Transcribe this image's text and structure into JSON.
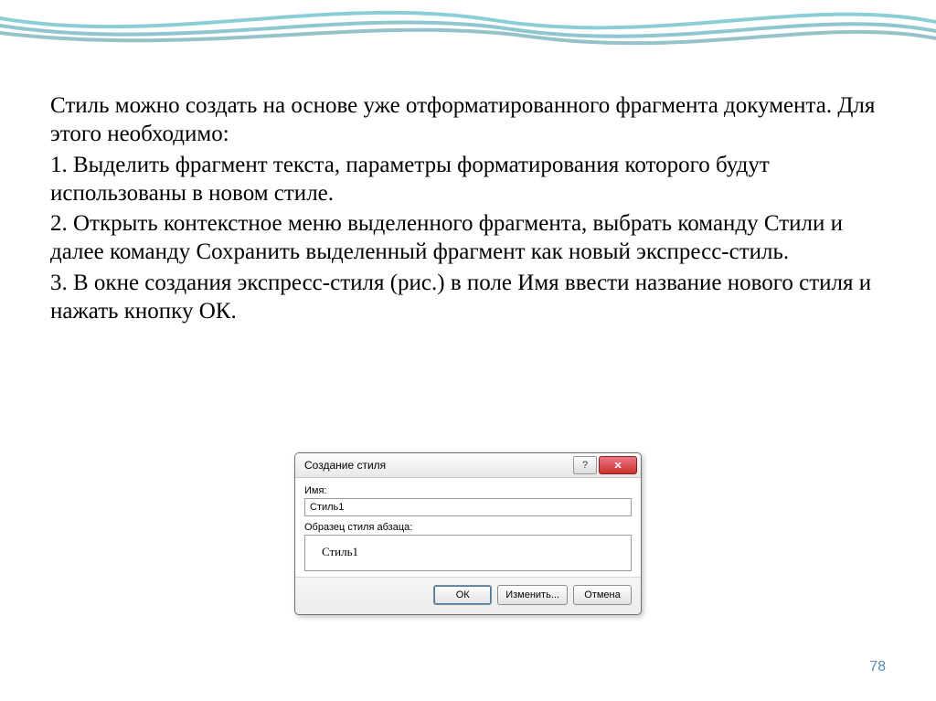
{
  "text": {
    "p1": "Стиль можно создать на основе уже отформатированного фрагмента документа. Для этого необходимо:",
    "p2": "1. Выделить фрагмент текста, параметры форматирования которого будут использованы в новом стиле.",
    "p3": "2. Открыть контекстное меню выделенного фрагмента, выбрать команду Стили и далее команду Сохранить выделенный фрагмент как новый экспресс-стиль.",
    "p4": "3. В окне создания экспресс-стиля (рис.) в поле Имя ввести название нового стиля и нажать кнопку ОК."
  },
  "dialog": {
    "title": "Создание стиля",
    "help_symbol": "?",
    "close_symbol": "x",
    "name_label": "Имя:",
    "name_value": "Стиль1",
    "preview_label": "Образец стиля абзаца:",
    "preview_value": "Стиль1",
    "ok": "ОК",
    "modify": "Изменить...",
    "cancel": "Отмена"
  },
  "page_number": "78"
}
